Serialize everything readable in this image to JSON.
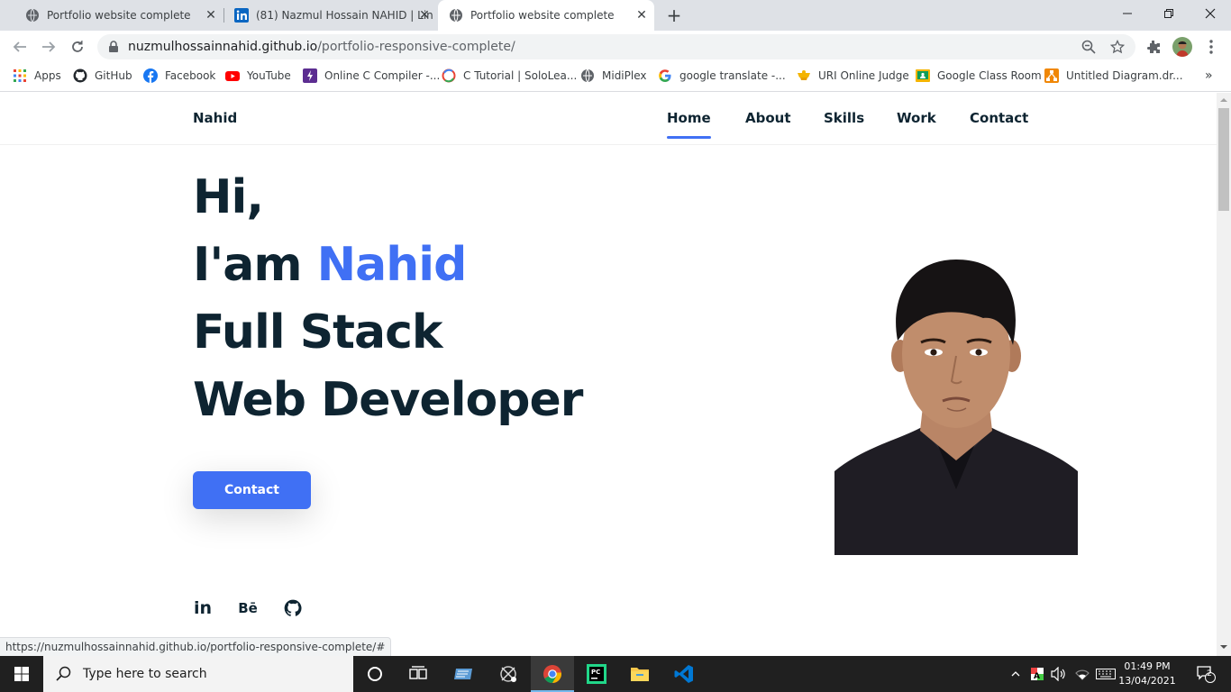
{
  "browser": {
    "tabs": [
      {
        "title": "Portfolio website complete",
        "favicon": "globe-icon",
        "active": false
      },
      {
        "title": "(81) Nazmul Hossain NAHID | Lin",
        "favicon": "linkedin-icon",
        "active": false
      },
      {
        "title": "Portfolio website complete",
        "favicon": "globe-icon",
        "active": true
      }
    ],
    "url_host": "nuzmulhossainnahid.github.io",
    "url_path": "/portfolio-responsive-complete/",
    "bookmarks": [
      {
        "label": "Apps",
        "icon": "apps-grid-icon"
      },
      {
        "label": "GitHub",
        "icon": "github-icon"
      },
      {
        "label": "Facebook",
        "icon": "facebook-icon"
      },
      {
        "label": "YouTube",
        "icon": "youtube-icon"
      },
      {
        "label": "Online C Compiler -...",
        "icon": "compiler-icon"
      },
      {
        "label": "C Tutorial | SoloLea...",
        "icon": "sololearn-icon"
      },
      {
        "label": "MidiPlex",
        "icon": "midiplex-icon"
      },
      {
        "label": "google translate -...",
        "icon": "google-icon"
      },
      {
        "label": "URI Online Judge",
        "icon": "uri-icon"
      },
      {
        "label": "Google Class Room",
        "icon": "classroom-icon"
      },
      {
        "label": "Untitled Diagram.dr...",
        "icon": "drawio-icon"
      }
    ]
  },
  "site": {
    "logo": "Nahid",
    "nav": [
      "Home",
      "About",
      "Skills",
      "Work",
      "Contact"
    ],
    "active_nav": "Home",
    "hero": {
      "line1": "Hi,",
      "line2_prefix": "I'am ",
      "line2_name": "Nahid",
      "line3": "Full Stack",
      "line4": "Web Developer"
    },
    "contact_button": "Contact",
    "social": [
      {
        "label": "in",
        "icon": "linkedin-icon"
      },
      {
        "label": "Bē",
        "icon": "behance-icon"
      },
      {
        "label": "",
        "icon": "github-icon"
      }
    ],
    "accent_color": "#4070f4",
    "text_color": "#0e2431"
  },
  "status_bar_url": "https://nuzmulhossainnahid.github.io/portfolio-responsive-complete/#",
  "taskbar": {
    "search_placeholder": "Type here to search",
    "time": "01:49 PM",
    "date": "13/04/2021",
    "notification_count": "2",
    "apps": [
      "task-view-icon",
      "taskbar-app-icon",
      "snipping-icon",
      "chrome-icon",
      "pycharm-icon",
      "file-explorer-icon",
      "vscode-icon"
    ]
  }
}
